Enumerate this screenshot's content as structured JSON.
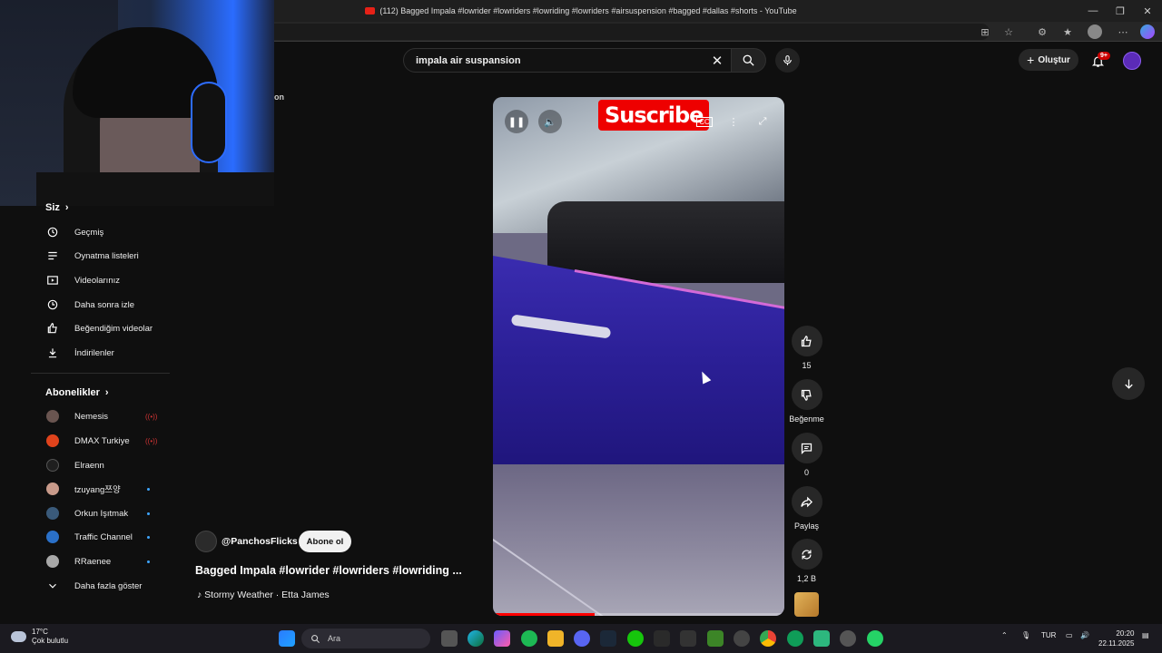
{
  "window": {
    "title": "(112) Bagged Impala #lowrider #lowriders #lowriding #lowriders #airsuspension #bagged #dallas #shorts - YouTube"
  },
  "header": {
    "search_value": "impala air suspansion",
    "create_label": "Oluştur",
    "notification_count": "9+",
    "partial_left_text": "on"
  },
  "sidebar": {
    "you_title": "Siz",
    "you_items": [
      {
        "label": "Geçmiş",
        "icon": "history-icon"
      },
      {
        "label": "Oynatma listeleri",
        "icon": "playlist-icon"
      },
      {
        "label": "Videolarınız",
        "icon": "your-videos-icon"
      },
      {
        "label": "Daha sonra izle",
        "icon": "watch-later-icon"
      },
      {
        "label": "Beğendiğim videolar",
        "icon": "liked-icon"
      },
      {
        "label": "İndirilenler",
        "icon": "download-icon"
      }
    ],
    "subs_title": "Abonelikler",
    "subs": [
      {
        "name": "Nemesis",
        "status": "live",
        "color": "#6a5550"
      },
      {
        "name": "DMAX Turkiye",
        "status": "live",
        "color": "#e0431c"
      },
      {
        "name": "Elraenn",
        "status": "",
        "color": "#1f1f1f"
      },
      {
        "name": "tzuyang쯔양",
        "status": "new",
        "color": "#c89a8a"
      },
      {
        "name": "Orkun Işıtmak",
        "status": "new",
        "color": "#3a5a7a"
      },
      {
        "name": "Traffic Channel",
        "status": "new",
        "color": "#2a70c8"
      },
      {
        "name": "RRaenee",
        "status": "new",
        "color": "#a8a8a8"
      }
    ],
    "show_more": "Daha fazla göster"
  },
  "video": {
    "overlay_text": "Suscribe",
    "progress": 0.35
  },
  "actions": {
    "likes": "15",
    "dislike_label": "Beğenme",
    "comments": "0",
    "share_label": "Paylaş",
    "remix": "1,2 B"
  },
  "channel": {
    "handle": "@PanchosFlicks",
    "subscribe_label": "Abone ol"
  },
  "video_title": "Bagged Impala #lowrider #lowriders #lowriding ...",
  "music": "Stormy Weather · Etta James",
  "taskbar": {
    "temp": "17°C",
    "weather_text": "Çok bulutlu",
    "search_placeholder": "Ara",
    "lang": "TUR",
    "time": "20:20",
    "date": "22.11.2025"
  }
}
